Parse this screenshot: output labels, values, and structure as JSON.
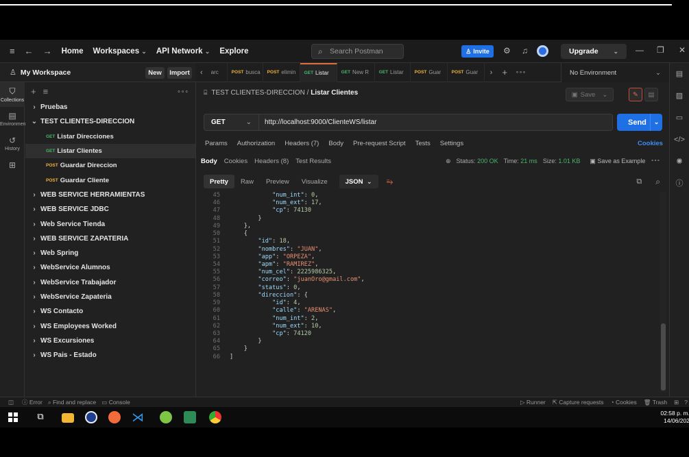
{
  "header": {
    "nav": [
      "Home",
      "Workspaces",
      "API Network",
      "Explore"
    ],
    "search_placeholder": "Search Postman",
    "invite_label": "Invite",
    "upgrade_label": "Upgrade"
  },
  "workspace": {
    "title": "My Workspace",
    "new_label": "New",
    "import_label": "Import"
  },
  "left_nav": [
    {
      "label": "Collections",
      "icon": "collections-icon"
    },
    {
      "label": "Environments",
      "icon": "environments-icon"
    },
    {
      "label": "History",
      "icon": "history-icon"
    },
    {
      "label": "",
      "icon": "flows-icon"
    }
  ],
  "tree": [
    {
      "label": "Pruebas",
      "type": "folder",
      "open": false
    },
    {
      "label": "TEST CLIENTES-DIRECCION",
      "type": "folder",
      "open": true
    },
    {
      "label": "Listar Direcciones",
      "type": "request",
      "method": "GET"
    },
    {
      "label": "Listar Clientes",
      "type": "request",
      "method": "GET",
      "selected": true
    },
    {
      "label": "Guardar Direccion",
      "type": "request",
      "method": "POST"
    },
    {
      "label": "Guardar Cliente",
      "type": "request",
      "method": "POST"
    },
    {
      "label": "WEB SERVICE HERRAMIENTAS",
      "type": "folder"
    },
    {
      "label": "WEB SERVICE JDBC",
      "type": "folder"
    },
    {
      "label": "Web Service Tienda",
      "type": "folder"
    },
    {
      "label": "WEB SERVICE ZAPATERIA",
      "type": "folder"
    },
    {
      "label": "Web Spring",
      "type": "folder"
    },
    {
      "label": "WebService Alumnos",
      "type": "folder"
    },
    {
      "label": "WebService Trabajador",
      "type": "folder"
    },
    {
      "label": "WebService Zapateria",
      "type": "folder"
    },
    {
      "label": "WS Contacto",
      "type": "folder"
    },
    {
      "label": "WS Employees Worked",
      "type": "folder"
    },
    {
      "label": "WS Excursiones",
      "type": "folder"
    },
    {
      "label": "WS Pais - Estado",
      "type": "folder"
    }
  ],
  "tabs": [
    {
      "method": "",
      "label": "arc"
    },
    {
      "method": "POST",
      "label": "busca"
    },
    {
      "method": "POST",
      "label": "elimin"
    },
    {
      "method": "GET",
      "label": "Listar",
      "active": true
    },
    {
      "method": "GET",
      "label": "New R"
    },
    {
      "method": "GET",
      "label": "Listar"
    },
    {
      "method": "POST",
      "label": "Guar"
    },
    {
      "method": "POST",
      "label": "Guar"
    }
  ],
  "environment": "No Environment",
  "request": {
    "collection": "TEST CLIENTES-DIRECCION",
    "name": "Listar Clientes",
    "method": "GET",
    "url": "http://localhost:9000/ClienteWS/listar",
    "send_label": "Send",
    "save_label": "Save"
  },
  "request_tabs": [
    "Params",
    "Authorization",
    "Headers (7)",
    "Body",
    "Pre-request Script",
    "Tests",
    "Settings"
  ],
  "cookies_label": "Cookies",
  "response_tabs": [
    "Body",
    "Cookies",
    "Headers (8)",
    "Test Results"
  ],
  "response_status": {
    "status_label": "Status:",
    "status": "200 OK",
    "time_label": "Time:",
    "time": "21 ms",
    "size_label": "Size:",
    "size": "1.01 KB",
    "save_example": "Save as Example"
  },
  "view_modes": [
    "Pretty",
    "Raw",
    "Preview",
    "Visualize"
  ],
  "format": "JSON",
  "code_lines": [
    {
      "n": 45,
      "indent": 12,
      "tokens": [
        [
          "k",
          "\"num_int\""
        ],
        [
          "p",
          ": "
        ],
        [
          "n",
          "0"
        ],
        [
          "p",
          ","
        ]
      ]
    },
    {
      "n": 46,
      "indent": 12,
      "tokens": [
        [
          "k",
          "\"num_ext\""
        ],
        [
          "p",
          ": "
        ],
        [
          "n",
          "17"
        ],
        [
          "p",
          ","
        ]
      ]
    },
    {
      "n": 47,
      "indent": 12,
      "tokens": [
        [
          "k",
          "\"cp\""
        ],
        [
          "p",
          ": "
        ],
        [
          "n",
          "74130"
        ]
      ]
    },
    {
      "n": 48,
      "indent": 8,
      "tokens": [
        [
          "p",
          "}"
        ]
      ]
    },
    {
      "n": 49,
      "indent": 4,
      "tokens": [
        [
          "p",
          "},"
        ]
      ]
    },
    {
      "n": 50,
      "indent": 4,
      "tokens": [
        [
          "p",
          "{"
        ]
      ]
    },
    {
      "n": 51,
      "indent": 8,
      "tokens": [
        [
          "k",
          "\"id\""
        ],
        [
          "p",
          ": "
        ],
        [
          "n",
          "18"
        ],
        [
          "p",
          ","
        ]
      ]
    },
    {
      "n": 52,
      "indent": 8,
      "tokens": [
        [
          "k",
          "\"nombres\""
        ],
        [
          "p",
          ": "
        ],
        [
          "s",
          "\"JUAN\""
        ],
        [
          "p",
          ","
        ]
      ]
    },
    {
      "n": 53,
      "indent": 8,
      "tokens": [
        [
          "k",
          "\"app\""
        ],
        [
          "p",
          ": "
        ],
        [
          "s",
          "\"ORPEZA\""
        ],
        [
          "p",
          ","
        ]
      ]
    },
    {
      "n": 54,
      "indent": 8,
      "tokens": [
        [
          "k",
          "\"apm\""
        ],
        [
          "p",
          ": "
        ],
        [
          "s",
          "\"RAMIREZ\""
        ],
        [
          "p",
          ","
        ]
      ]
    },
    {
      "n": 55,
      "indent": 8,
      "tokens": [
        [
          "k",
          "\"num_cel\""
        ],
        [
          "p",
          ": "
        ],
        [
          "n",
          "2225986325"
        ],
        [
          "p",
          ","
        ]
      ]
    },
    {
      "n": 56,
      "indent": 8,
      "tokens": [
        [
          "k",
          "\"correo\""
        ],
        [
          "p",
          ": "
        ],
        [
          "s",
          "\"juanOro@gmail.com\""
        ],
        [
          "p",
          ","
        ]
      ]
    },
    {
      "n": 57,
      "indent": 8,
      "tokens": [
        [
          "k",
          "\"status\""
        ],
        [
          "p",
          ": "
        ],
        [
          "n",
          "0"
        ],
        [
          "p",
          ","
        ]
      ]
    },
    {
      "n": 58,
      "indent": 8,
      "tokens": [
        [
          "k",
          "\"direccion\""
        ],
        [
          "p",
          ": {"
        ]
      ]
    },
    {
      "n": 59,
      "indent": 12,
      "tokens": [
        [
          "k",
          "\"id\""
        ],
        [
          "p",
          ": "
        ],
        [
          "n",
          "4"
        ],
        [
          "p",
          ","
        ]
      ]
    },
    {
      "n": 60,
      "indent": 12,
      "tokens": [
        [
          "k",
          "\"calle\""
        ],
        [
          "p",
          ": "
        ],
        [
          "s",
          "\"ARENAS\""
        ],
        [
          "p",
          ","
        ]
      ]
    },
    {
      "n": 61,
      "indent": 12,
      "tokens": [
        [
          "k",
          "\"num_int\""
        ],
        [
          "p",
          ": "
        ],
        [
          "n",
          "2"
        ],
        [
          "p",
          ","
        ]
      ]
    },
    {
      "n": 62,
      "indent": 12,
      "tokens": [
        [
          "k",
          "\"num_ext\""
        ],
        [
          "p",
          ": "
        ],
        [
          "n",
          "10"
        ],
        [
          "p",
          ","
        ]
      ]
    },
    {
      "n": 63,
      "indent": 12,
      "tokens": [
        [
          "k",
          "\"cp\""
        ],
        [
          "p",
          ": "
        ],
        [
          "n",
          "74120"
        ]
      ]
    },
    {
      "n": 64,
      "indent": 8,
      "tokens": [
        [
          "p",
          "}"
        ]
      ]
    },
    {
      "n": 65,
      "indent": 4,
      "tokens": [
        [
          "p",
          "}"
        ]
      ]
    },
    {
      "n": 66,
      "indent": 0,
      "tokens": [
        [
          "p",
          "]"
        ]
      ]
    }
  ],
  "footer": {
    "error": "Error",
    "find_replace": "Find and replace",
    "console": "Console",
    "runner": "Runner",
    "capture": "Capture requests",
    "cookies": "Cookies",
    "trash": "Trash"
  },
  "clock": {
    "time": "02:58 p. m.",
    "date": "14/06/202"
  },
  "colors": {
    "accent": "#1f6fe5",
    "get": "#4ab56b",
    "post": "#f3b23d",
    "status_ok": "#4ab56b"
  }
}
